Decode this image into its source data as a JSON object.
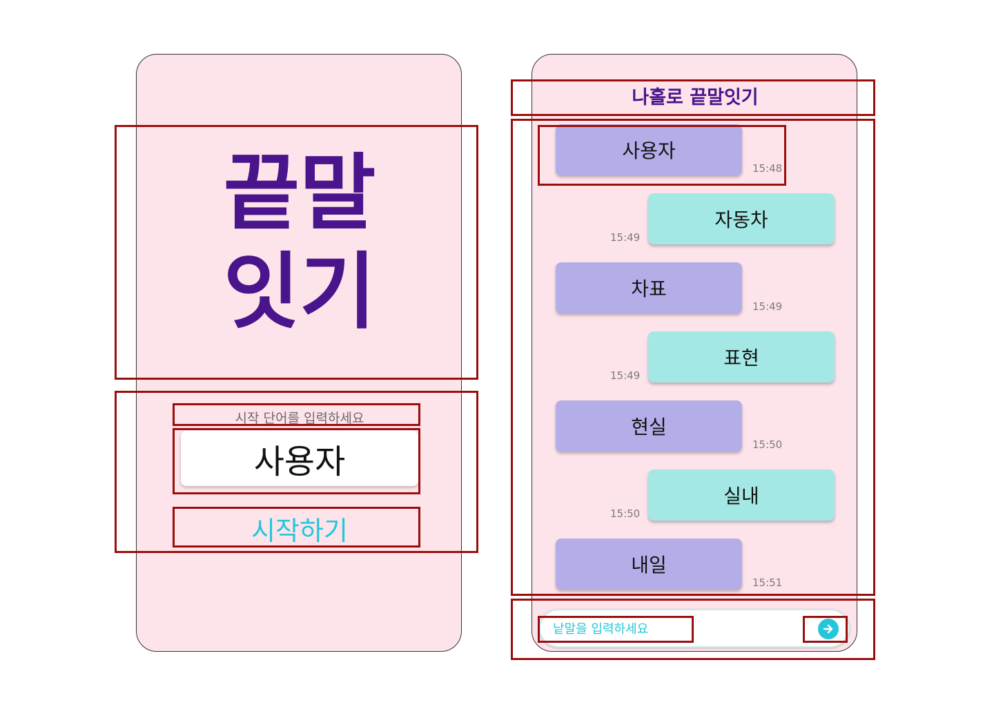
{
  "start_screen": {
    "title_line_1": "끝말",
    "title_line_2": "잇기",
    "hint": "시작 단어를 입력하세요",
    "start_word_value": "사용자",
    "start_button_label": "시작하기"
  },
  "chat_screen": {
    "title": "나홀로 끝말잇기",
    "messages": [
      {
        "sender": "user",
        "text": "사용자",
        "time": "15:48"
      },
      {
        "sender": "computer",
        "text": "자동차",
        "time": "15:49"
      },
      {
        "sender": "user",
        "text": "차표",
        "time": "15:49"
      },
      {
        "sender": "computer",
        "text": "표현",
        "time": "15:49"
      },
      {
        "sender": "user",
        "text": "현실",
        "time": "15:50"
      },
      {
        "sender": "computer",
        "text": "실내",
        "time": "15:50"
      },
      {
        "sender": "user",
        "text": "내일",
        "time": "15:51"
      }
    ],
    "input_placeholder": "낱말을 입력하세요",
    "send_icon": "arrow-right-icon"
  },
  "colors": {
    "screen_background": "#fde4ea",
    "title_purple": "#4a148c",
    "accent_cyan": "#26c6da",
    "user_bubble": "#b3aee8",
    "computer_bubble": "#a4e8e5",
    "annotation_red": "#9b0d0d"
  }
}
